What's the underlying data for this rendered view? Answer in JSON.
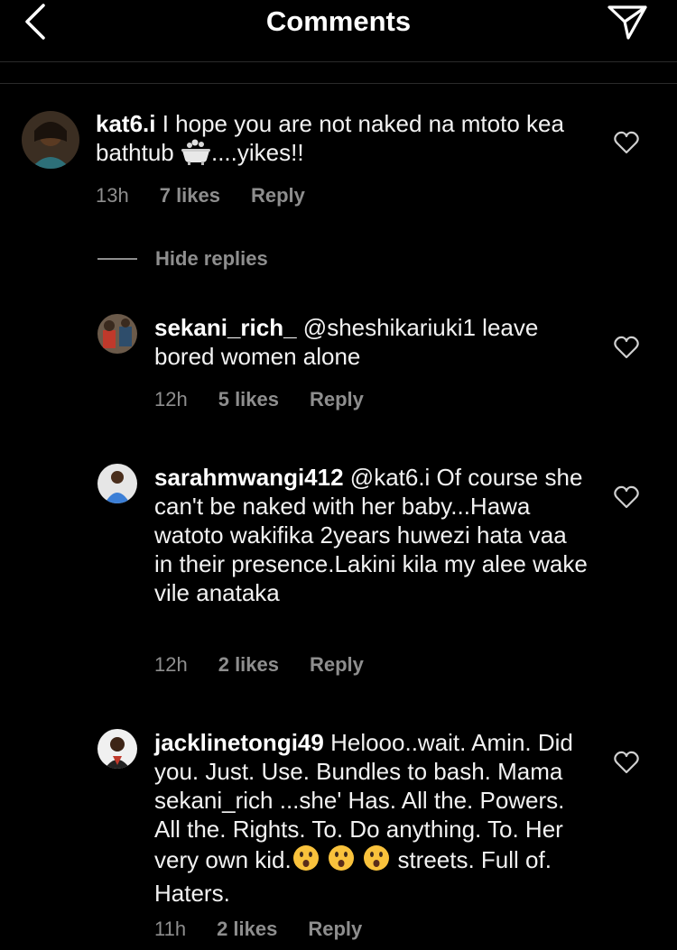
{
  "header": {
    "title": "Comments",
    "back_icon": "chevron-left-icon",
    "send_icon": "send-direct-icon"
  },
  "hide_replies_label": "Hide replies",
  "comments": [
    {
      "username": "kat6.i",
      "text_before": "I hope you are not naked na mtoto kea bathtub ",
      "emoji": "bathtub",
      "text_after": "....yikes!!",
      "time": "13h",
      "likes": "7 likes",
      "reply": "Reply"
    },
    {
      "username": "sekani_rich_",
      "text": "@sheshikariuki1 leave bored women alone",
      "time": "12h",
      "likes": "5 likes",
      "reply": "Reply"
    },
    {
      "username": "sarahmwangi412",
      "text": "@kat6.i Of course she can't be naked with her baby...Hawa watoto wakifika 2years huwezi hata vaa in their presence.Lakini kila my alee wake vile anataka",
      "time": "12h",
      "likes": "2 likes",
      "reply": "Reply"
    },
    {
      "username": "jacklinetongi49",
      "text_before": "Helooo..wait. Amin. Did you. Just. Use. Bundles to bash. Mama sekani_rich ...she'  Has.  All the.  Powers. All the. Rights.  To. Do anything.  To. Her very own kid.",
      "emoji": "hushed-face",
      "text_after": "streets. Full of. Haters.",
      "time": "11h",
      "likes": "2 likes",
      "reply": "Reply"
    }
  ],
  "colors": {
    "background": "#000000",
    "text": "#f2f2f2",
    "muted": "#8e8e8e",
    "divider": "#2a2a2a",
    "emoji_face": "#f9c23c"
  }
}
